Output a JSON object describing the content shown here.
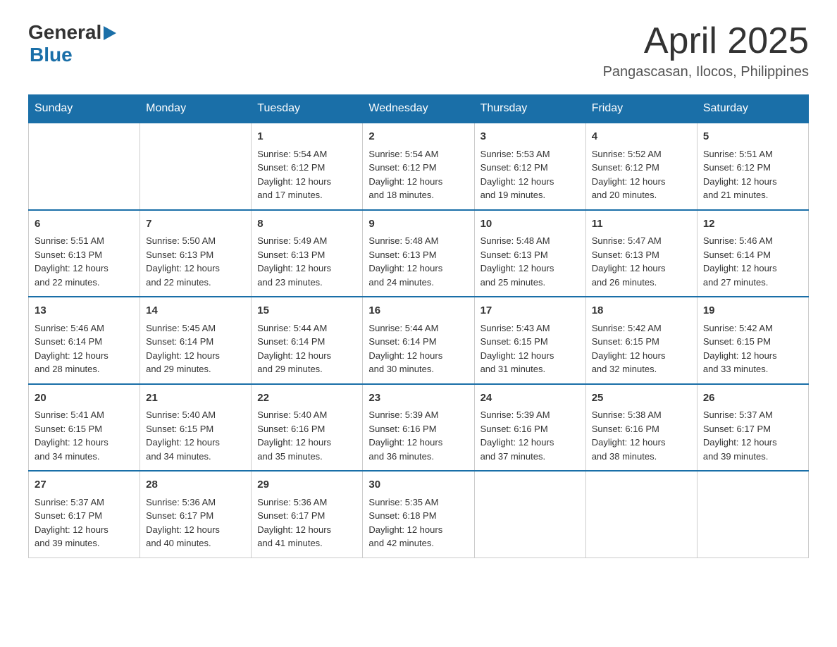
{
  "header": {
    "logo": {
      "general": "General",
      "blue": "Blue",
      "arrow_color": "#1a6fa8"
    },
    "title": "April 2025",
    "location": "Pangascasan, Ilocos, Philippines"
  },
  "calendar": {
    "days_of_week": [
      "Sunday",
      "Monday",
      "Tuesday",
      "Wednesday",
      "Thursday",
      "Friday",
      "Saturday"
    ],
    "weeks": [
      [
        {
          "day": "",
          "info": ""
        },
        {
          "day": "",
          "info": ""
        },
        {
          "day": "1",
          "info": "Sunrise: 5:54 AM\nSunset: 6:12 PM\nDaylight: 12 hours\nand 17 minutes."
        },
        {
          "day": "2",
          "info": "Sunrise: 5:54 AM\nSunset: 6:12 PM\nDaylight: 12 hours\nand 18 minutes."
        },
        {
          "day": "3",
          "info": "Sunrise: 5:53 AM\nSunset: 6:12 PM\nDaylight: 12 hours\nand 19 minutes."
        },
        {
          "day": "4",
          "info": "Sunrise: 5:52 AM\nSunset: 6:12 PM\nDaylight: 12 hours\nand 20 minutes."
        },
        {
          "day": "5",
          "info": "Sunrise: 5:51 AM\nSunset: 6:12 PM\nDaylight: 12 hours\nand 21 minutes."
        }
      ],
      [
        {
          "day": "6",
          "info": "Sunrise: 5:51 AM\nSunset: 6:13 PM\nDaylight: 12 hours\nand 22 minutes."
        },
        {
          "day": "7",
          "info": "Sunrise: 5:50 AM\nSunset: 6:13 PM\nDaylight: 12 hours\nand 22 minutes."
        },
        {
          "day": "8",
          "info": "Sunrise: 5:49 AM\nSunset: 6:13 PM\nDaylight: 12 hours\nand 23 minutes."
        },
        {
          "day": "9",
          "info": "Sunrise: 5:48 AM\nSunset: 6:13 PM\nDaylight: 12 hours\nand 24 minutes."
        },
        {
          "day": "10",
          "info": "Sunrise: 5:48 AM\nSunset: 6:13 PM\nDaylight: 12 hours\nand 25 minutes."
        },
        {
          "day": "11",
          "info": "Sunrise: 5:47 AM\nSunset: 6:13 PM\nDaylight: 12 hours\nand 26 minutes."
        },
        {
          "day": "12",
          "info": "Sunrise: 5:46 AM\nSunset: 6:14 PM\nDaylight: 12 hours\nand 27 minutes."
        }
      ],
      [
        {
          "day": "13",
          "info": "Sunrise: 5:46 AM\nSunset: 6:14 PM\nDaylight: 12 hours\nand 28 minutes."
        },
        {
          "day": "14",
          "info": "Sunrise: 5:45 AM\nSunset: 6:14 PM\nDaylight: 12 hours\nand 29 minutes."
        },
        {
          "day": "15",
          "info": "Sunrise: 5:44 AM\nSunset: 6:14 PM\nDaylight: 12 hours\nand 29 minutes."
        },
        {
          "day": "16",
          "info": "Sunrise: 5:44 AM\nSunset: 6:14 PM\nDaylight: 12 hours\nand 30 minutes."
        },
        {
          "day": "17",
          "info": "Sunrise: 5:43 AM\nSunset: 6:15 PM\nDaylight: 12 hours\nand 31 minutes."
        },
        {
          "day": "18",
          "info": "Sunrise: 5:42 AM\nSunset: 6:15 PM\nDaylight: 12 hours\nand 32 minutes."
        },
        {
          "day": "19",
          "info": "Sunrise: 5:42 AM\nSunset: 6:15 PM\nDaylight: 12 hours\nand 33 minutes."
        }
      ],
      [
        {
          "day": "20",
          "info": "Sunrise: 5:41 AM\nSunset: 6:15 PM\nDaylight: 12 hours\nand 34 minutes."
        },
        {
          "day": "21",
          "info": "Sunrise: 5:40 AM\nSunset: 6:15 PM\nDaylight: 12 hours\nand 34 minutes."
        },
        {
          "day": "22",
          "info": "Sunrise: 5:40 AM\nSunset: 6:16 PM\nDaylight: 12 hours\nand 35 minutes."
        },
        {
          "day": "23",
          "info": "Sunrise: 5:39 AM\nSunset: 6:16 PM\nDaylight: 12 hours\nand 36 minutes."
        },
        {
          "day": "24",
          "info": "Sunrise: 5:39 AM\nSunset: 6:16 PM\nDaylight: 12 hours\nand 37 minutes."
        },
        {
          "day": "25",
          "info": "Sunrise: 5:38 AM\nSunset: 6:16 PM\nDaylight: 12 hours\nand 38 minutes."
        },
        {
          "day": "26",
          "info": "Sunrise: 5:37 AM\nSunset: 6:17 PM\nDaylight: 12 hours\nand 39 minutes."
        }
      ],
      [
        {
          "day": "27",
          "info": "Sunrise: 5:37 AM\nSunset: 6:17 PM\nDaylight: 12 hours\nand 39 minutes."
        },
        {
          "day": "28",
          "info": "Sunrise: 5:36 AM\nSunset: 6:17 PM\nDaylight: 12 hours\nand 40 minutes."
        },
        {
          "day": "29",
          "info": "Sunrise: 5:36 AM\nSunset: 6:17 PM\nDaylight: 12 hours\nand 41 minutes."
        },
        {
          "day": "30",
          "info": "Sunrise: 5:35 AM\nSunset: 6:18 PM\nDaylight: 12 hours\nand 42 minutes."
        },
        {
          "day": "",
          "info": ""
        },
        {
          "day": "",
          "info": ""
        },
        {
          "day": "",
          "info": ""
        }
      ]
    ]
  }
}
